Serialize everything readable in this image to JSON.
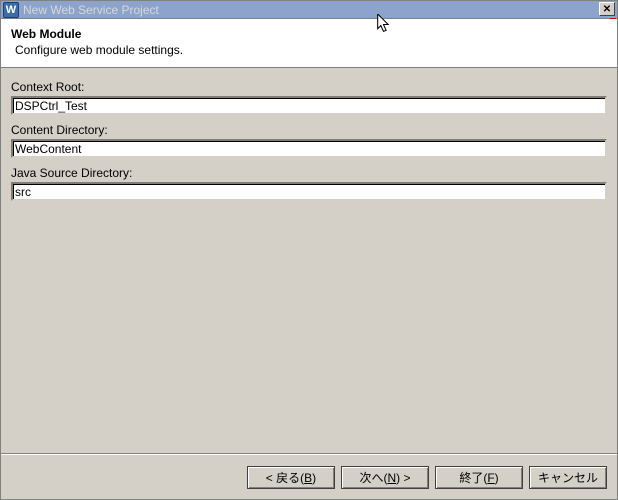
{
  "window": {
    "title": "New Web Service Project"
  },
  "header": {
    "title": "Web Module",
    "description": "Configure web module settings."
  },
  "form": {
    "contextRoot": {
      "label": "Context Root:",
      "value": "DSPCtrl_Test"
    },
    "contentDirectory": {
      "label": "Content Directory:",
      "value": "WebContent"
    },
    "javaSourceDirectory": {
      "label": "Java Source Directory:",
      "value": "src"
    }
  },
  "buttons": {
    "back_prefix": "< 戻る(",
    "back_u": "B",
    "back_suffix": ")",
    "next_prefix": "次へ(",
    "next_u": "N",
    "next_suffix": ") >",
    "finish_prefix": "終了(",
    "finish_u": "F",
    "finish_suffix": ")",
    "cancel": "キャンセル"
  }
}
